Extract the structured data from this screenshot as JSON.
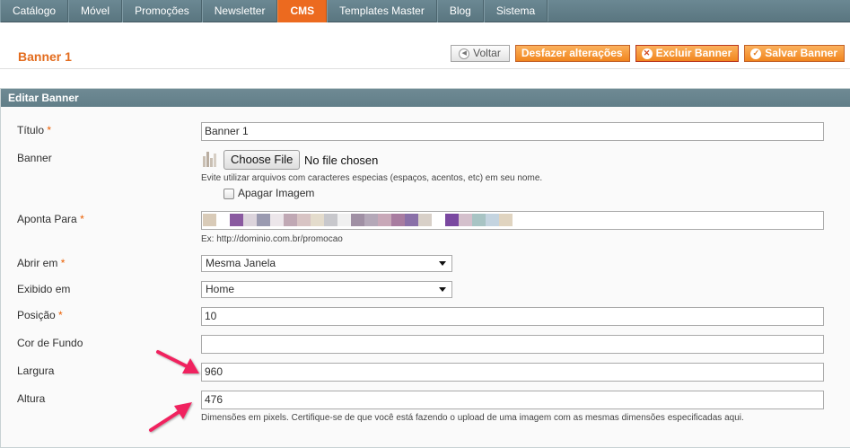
{
  "nav": {
    "items": [
      "Catálogo",
      "Móvel",
      "Promoções",
      "Newsletter",
      "CMS",
      "Templates Master",
      "Blog",
      "Sistema"
    ],
    "active": "CMS"
  },
  "header": {
    "title": "Banner 1",
    "back_label": "Voltar",
    "reset_label": "Desfazer alterações",
    "delete_label": "Excluir Banner",
    "save_label": "Salvar Banner"
  },
  "panel": {
    "title": "Editar Banner"
  },
  "form": {
    "titulo": {
      "label": "Título",
      "required": "*",
      "value": "Banner 1"
    },
    "banner": {
      "label": "Banner",
      "file_button": "Choose File",
      "file_status": "No file chosen",
      "hint": "Evite utilizar arquivos com caracteres especias (espaços, acentos, etc) em seu nome.",
      "delete_label": "Apagar Imagem"
    },
    "aponta_para": {
      "label": "Aponta Para",
      "required": "*",
      "hint": "Ex: http://dominio.com.br/promocao"
    },
    "abrir_em": {
      "label": "Abrir em",
      "required": "*",
      "value": "Mesma Janela"
    },
    "exibido_em": {
      "label": "Exibido em",
      "value": "Home"
    },
    "posicao": {
      "label": "Posição",
      "required": "*",
      "value": "10"
    },
    "cor_de_fundo": {
      "label": "Cor de Fundo",
      "value": ""
    },
    "largura": {
      "label": "Largura",
      "value": "960"
    },
    "altura": {
      "label": "Altura",
      "value": "476",
      "hint": "Dimensões em pixels. Certifique-se de que você está fazendo o upload de uma imagem com as mesmas dimensões especificadas aqui."
    }
  },
  "colors": {
    "accent": "#ec6a1f",
    "nav_bg": "#617e88",
    "annotation_arrow": "#f0245e"
  },
  "icons": {
    "back": "arrow-left-circle-icon",
    "delete": "x-circle-icon",
    "save": "checkmark-circle-icon",
    "select": "chevron-down-icon"
  }
}
